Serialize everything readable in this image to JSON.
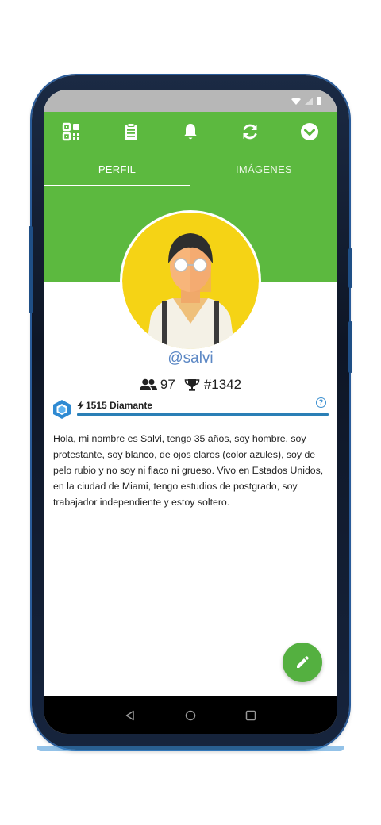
{
  "colors": {
    "primary_green": "#5cb93f",
    "username_blue": "#5b87c4",
    "rank_bar_blue": "#2a7fb6"
  },
  "toolbar": {
    "icons": [
      "qr-code-icon",
      "clipboard-icon",
      "bell-icon",
      "refresh-icon",
      "chevron-down-circle-icon"
    ]
  },
  "tabs": [
    {
      "label": "PERFIL",
      "active": true
    },
    {
      "label": "IMÁGENES",
      "active": false
    }
  ],
  "profile": {
    "username": "@salvi",
    "friends_count": "97",
    "ranking": "#1342",
    "rank_points_label": "1515 Diamante",
    "bio": "Hola, mi nombre es Salvi, tengo 35 años, soy hombre, soy protestante, soy blanco, de ojos claros (color azules), soy de pelo rubio y no soy ni flaco ni grueso. Vivo en Estados Unidos, en la ciudad de Miami, tengo estudios de postgrado, soy trabajador independiente y estoy soltero."
  },
  "fab": {
    "icon": "pencil-icon"
  },
  "nav": {
    "icons": [
      "back-icon",
      "home-icon",
      "recents-icon"
    ]
  }
}
